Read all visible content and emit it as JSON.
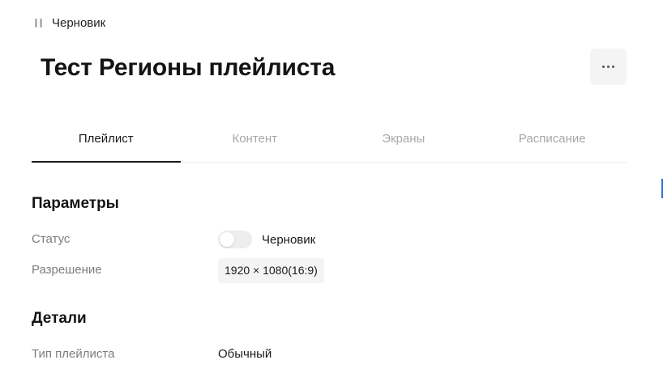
{
  "header": {
    "status_text": "Черновик",
    "title": "Тест Регионы плейлиста",
    "more_icon": "more-horizontal-icon"
  },
  "tabs": [
    {
      "label": "Плейлист",
      "active": true
    },
    {
      "label": "Контент",
      "active": false
    },
    {
      "label": "Экраны",
      "active": false
    },
    {
      "label": "Расписание",
      "active": false
    }
  ],
  "parameters": {
    "title": "Параметры",
    "status_label": "Статус",
    "status_value": "Черновик",
    "status_toggle_on": false,
    "resolution_label": "Разрешение",
    "resolution_value": "1920 × 1080(16:9)"
  },
  "details": {
    "title": "Детали",
    "playlist_type_label": "Тип плейлиста",
    "playlist_type_value": "Обычный"
  },
  "colors": {
    "accent": "#2f6fd6",
    "text_primary": "#1a1a1a",
    "text_muted": "#7d7d7d",
    "tab_inactive": "#a8a8a8"
  }
}
